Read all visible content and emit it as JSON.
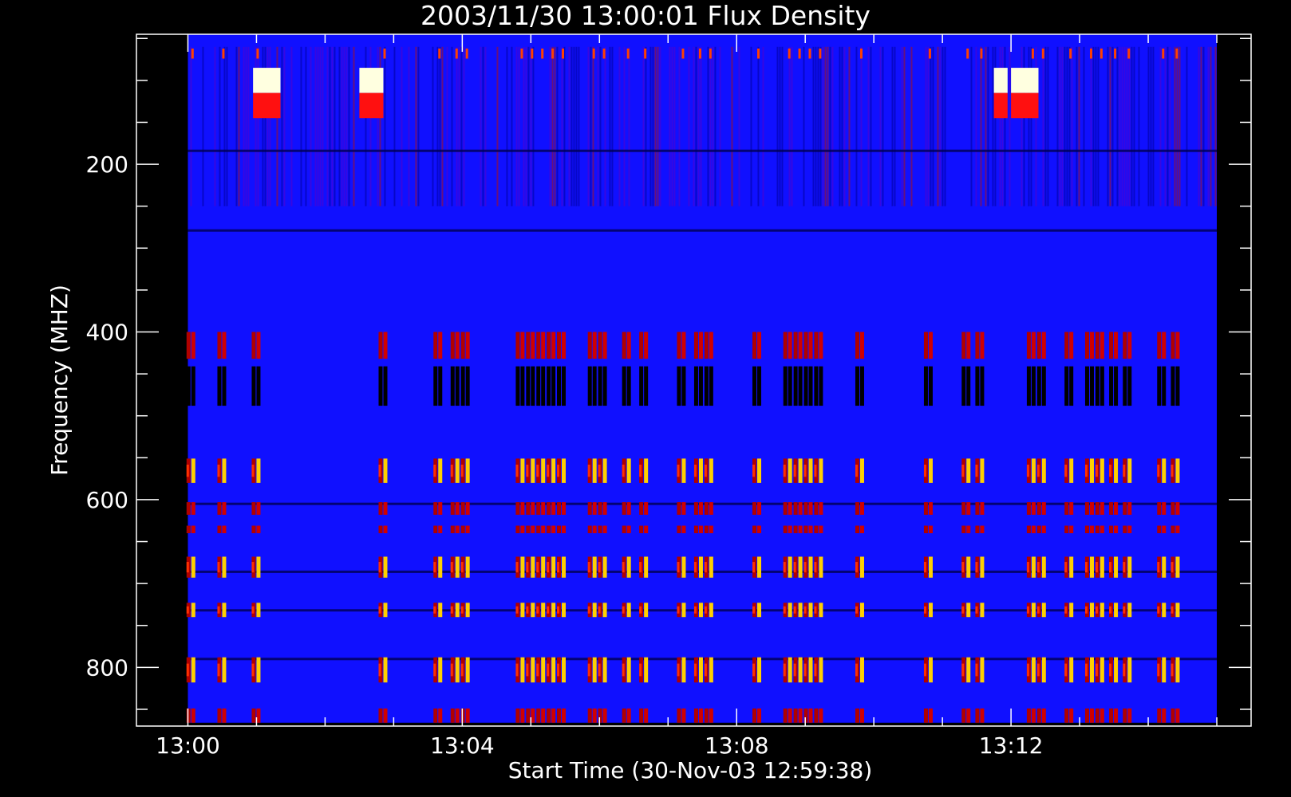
{
  "chart_data": {
    "type": "heatmap",
    "title": "2003/11/30 13:00:01 Flux Density",
    "xlabel": "Start Time (30-Nov-03 12:59:38)",
    "ylabel": "Frequency (MHZ)",
    "xlim_minutes_after_1300": [
      -0.75,
      15.5
    ],
    "ylim_mhz": [
      870,
      45
    ],
    "data_x_range_minutes": [
      0.0,
      15.0
    ],
    "data_y_range_mhz": [
      45,
      866
    ],
    "x_ticks": [
      {
        "label": "13:00",
        "minutes": 0
      },
      {
        "label": "13:04",
        "minutes": 4
      },
      {
        "label": "13:08",
        "minutes": 8
      },
      {
        "label": "13:12",
        "minutes": 12
      }
    ],
    "x_minor_tick_interval_minutes": 1,
    "y_ticks": [
      {
        "label": "200",
        "mhz": 200
      },
      {
        "label": "400",
        "mhz": 400
      },
      {
        "label": "600",
        "mhz": 600
      },
      {
        "label": "800",
        "mhz": 800
      }
    ],
    "y_minor_tick_interval_mhz": 50,
    "colormap": [
      "#000000",
      "#0000ff",
      "#2020ff",
      "#a00000",
      "#ff2000",
      "#ff9000",
      "#ffff00",
      "#ffffe0"
    ],
    "background_level": "#1010ff",
    "emission_columns_minutes": [
      0.05,
      0.5,
      1.0,
      2.85,
      3.65,
      3.9,
      4.05,
      4.85,
      5.0,
      5.15,
      5.3,
      5.45,
      5.9,
      6.05,
      6.4,
      6.65,
      7.2,
      7.45,
      7.6,
      8.3,
      8.75,
      8.9,
      9.05,
      9.2,
      9.8,
      10.8,
      11.35,
      11.55,
      12.3,
      12.45,
      12.85,
      13.15,
      13.3,
      13.5,
      13.7,
      14.2,
      14.4
    ],
    "emission_bands_mhz": [
      {
        "from": 400,
        "to": 432,
        "intensity": "red"
      },
      {
        "from": 441,
        "to": 488,
        "intensity": "black"
      },
      {
        "from": 551,
        "to": 580,
        "intensity": "yellow"
      },
      {
        "from": 603,
        "to": 618,
        "intensity": "red"
      },
      {
        "from": 631,
        "to": 640,
        "intensity": "red"
      },
      {
        "from": 668,
        "to": 693,
        "intensity": "yellow"
      },
      {
        "from": 723,
        "to": 740,
        "intensity": "yellow"
      },
      {
        "from": 788,
        "to": 818,
        "intensity": "yellow"
      },
      {
        "from": 849,
        "to": 866,
        "intensity": "red"
      }
    ],
    "saturated_blocks": [
      {
        "x_from": 0.95,
        "x_to": 1.35,
        "y_from": 85,
        "y_to": 145
      },
      {
        "x_from": 2.5,
        "x_to": 2.85,
        "y_from": 85,
        "y_to": 145
      },
      {
        "x_from": 11.75,
        "x_to": 11.95,
        "y_from": 85,
        "y_to": 145
      },
      {
        "x_from": 12.0,
        "x_to": 12.4,
        "y_from": 85,
        "y_to": 145
      }
    ],
    "horizontal_lines_mhz": [
      184,
      279,
      605,
      686,
      732,
      790
    ],
    "grid": false,
    "legend": "none"
  }
}
